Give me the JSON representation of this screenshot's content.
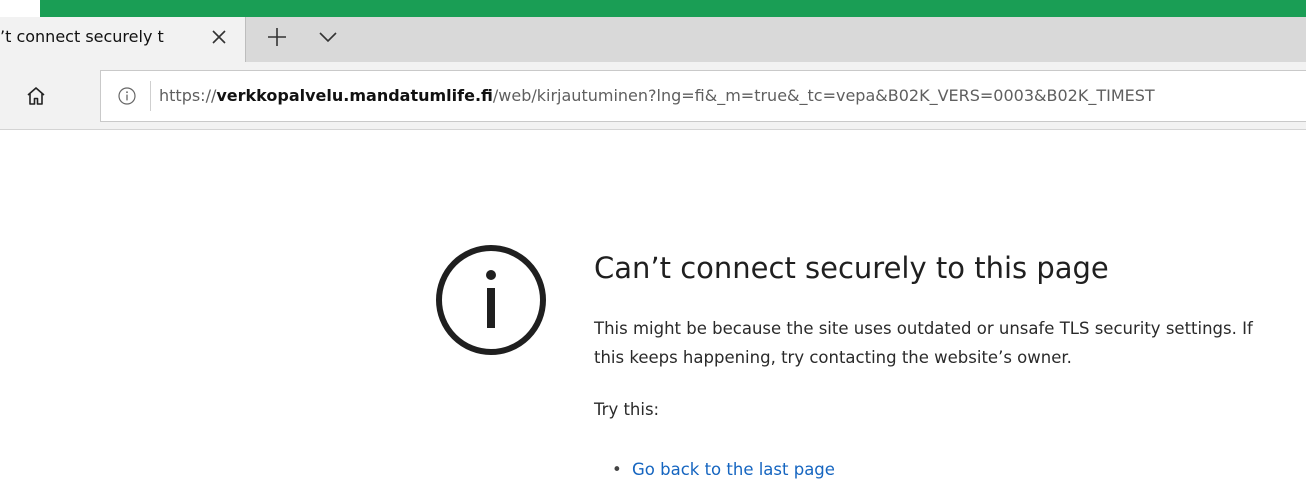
{
  "browser": {
    "tab": {
      "title": "’t connect securely t",
      "close_icon": "close-icon"
    },
    "new_tab_icon": "plus-icon",
    "tab_list_icon": "chevron-down-icon",
    "accent_color": "#1a9e55",
    "home_icon": "home-icon",
    "address_bar": {
      "info_icon": "info-icon",
      "url_scheme": "https://",
      "url_host": "verkkopalvelu.mandatumlife.fi",
      "url_path": "/web/kirjautuminen?lng=fi&_m=true&_tc=vepa&B02K_VERS=0003&B02K_TIMEST"
    }
  },
  "error_page": {
    "icon": "info-circle-icon",
    "title": "Can’t connect securely to this page",
    "description": "This might be because the site uses outdated or unsafe TLS security settings. If this keeps happening, try contacting the website’s owner.",
    "try_this_label": "Try this:",
    "suggestions": [
      {
        "bullet": "•",
        "label": "Go back to the last page",
        "link_color": "#1565c0"
      }
    ]
  }
}
